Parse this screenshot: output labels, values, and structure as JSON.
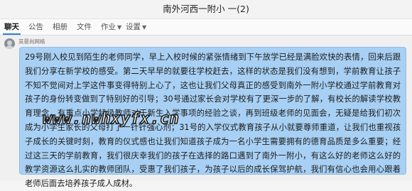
{
  "window": {
    "title": "南外河西一附小 一(2)"
  },
  "tabs": [
    {
      "label": "聊天"
    },
    {
      "label": "公告"
    },
    {
      "label": "相册"
    },
    {
      "label": "文件"
    },
    {
      "label": "作业"
    },
    {
      "label": "设置"
    }
  ],
  "message": {
    "sender": "吴曼尚网格",
    "text": "29号刚入校见到陌生的老师同学，早上入校时候的紧张情绪到下午放学已经是满脸欢快的表情，回来后跟我们分享在新学校的感受。第二天早早的就要往学校赶去，这样的状态是我们没有想到，学前教育让孩子不知不觉间对上学这件事变得特别上心了，这也让我们父母真正的感受到南外一附小学校通过学前教育对孩子的身份转变做到了特别好的引导；30号通过家长会对学校有了更深一步的了解，有校长的解读学校教育理念，有重点小学特级教师对于新生入学事项的经验之谈，再到班级老师的见面会，无疑是给我们初次成为小学生家长的父母打了一针针强心剂；31号的入学仪式教育孩子从小就要尊师重道，让我们也重视孩子成长的关键时刻，教育的仪式感也让我们知道孩子成为一名小学生需要拥有的德育品质是多么重要；经过这三天的学前教育，我们很庆幸我们的孩子在选择的路口遇到了南外一附小，有这么好的老师这么好的教学资源这么扎实的教师团队，受惠了我们孩子，为孩子以后的成长保驾护航，我们有信心也会用心跟着老师后面去培养孩子成人成材。"
  },
  "watermark": "www.nwhxyfx.cn",
  "colors": {
    "bubble": "#a8d0f4",
    "tab_active": "#2f7fd8"
  },
  "icons": {
    "dropdown": "chevron-down-icon"
  }
}
